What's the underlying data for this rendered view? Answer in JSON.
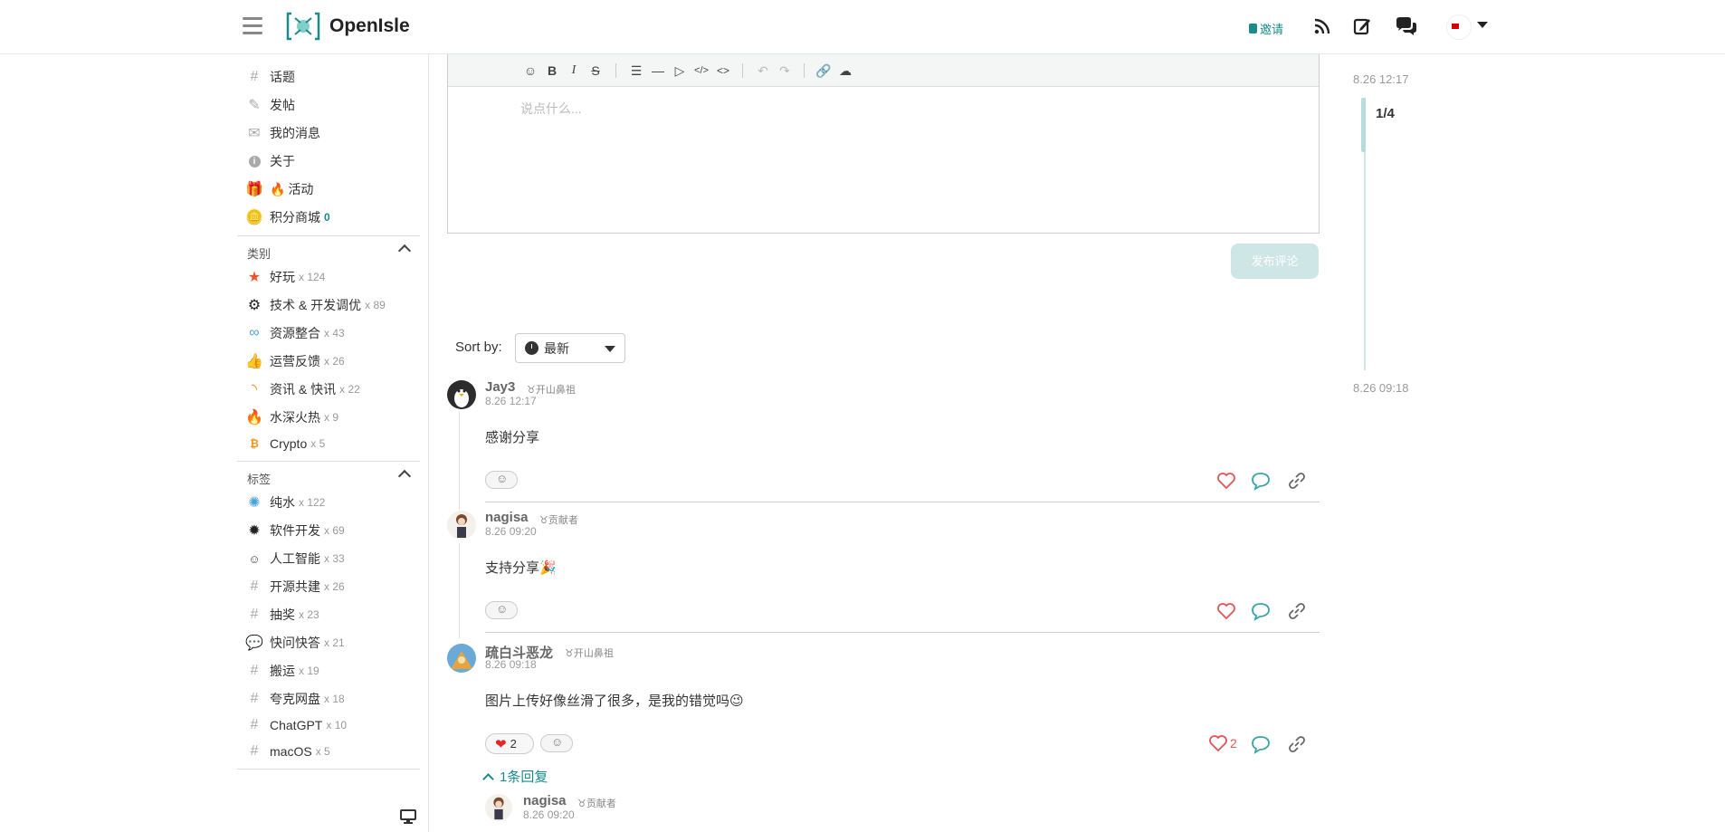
{
  "header": {
    "brand": "OpenIsle",
    "invite_label": "邀请"
  },
  "sidebar": {
    "nav": [
      {
        "label": "话题",
        "icon": "hash-icon"
      },
      {
        "label": "发帖",
        "icon": "edit-icon"
      },
      {
        "label": "我的消息",
        "icon": "mail-icon"
      },
      {
        "label": "关于",
        "icon": "info-icon"
      },
      {
        "label": "活动",
        "icon": "gift-icon"
      },
      {
        "label": "积分商城",
        "icon": "coins-icon",
        "count": "0"
      }
    ],
    "categories_title": "类别",
    "categories": [
      {
        "label": "好玩",
        "count": "x 124"
      },
      {
        "label": "技术 & 开发调优",
        "count": "x 89"
      },
      {
        "label": "资源整合",
        "count": "x 43"
      },
      {
        "label": "运营反馈",
        "count": "x 26"
      },
      {
        "label": "资讯 & 快讯",
        "count": "x 22"
      },
      {
        "label": "水深火热",
        "count": "x 9"
      },
      {
        "label": "Crypto",
        "count": "x 5"
      }
    ],
    "tags_title": "标签",
    "tags": [
      {
        "label": "纯水",
        "count": "x 122"
      },
      {
        "label": "软件开发",
        "count": "x 69"
      },
      {
        "label": "人工智能",
        "count": "x 33"
      },
      {
        "label": "开源共建",
        "count": "x 26"
      },
      {
        "label": "抽奖",
        "count": "x 23"
      },
      {
        "label": "快问快答",
        "count": "x 21"
      },
      {
        "label": "搬运",
        "count": "x 19"
      },
      {
        "label": "夸克网盘",
        "count": "x 18"
      },
      {
        "label": "ChatGPT",
        "count": "x 10"
      },
      {
        "label": "macOS",
        "count": "x 5"
      }
    ]
  },
  "editor": {
    "placeholder": "说点什么...",
    "submit_label": "发布评论"
  },
  "sort": {
    "label": "Sort by:",
    "selected": "最新"
  },
  "timeline": {
    "top_time": "8.26 12:17",
    "position": "1/4",
    "bottom_time": "8.26 09:18"
  },
  "comments": [
    {
      "author": "Jay3",
      "badge": "开山鼻祖",
      "time": "8.26 12:17",
      "text": "感谢分享"
    },
    {
      "author": "nagisa",
      "badge": "贡献者",
      "time": "8.26 09:20",
      "text": "支持分享🎉"
    },
    {
      "author": "疏白斗恶龙",
      "badge": "开山鼻祖",
      "time": "8.26 09:18",
      "text": "图片上传好像丝滑了很多，是我的错觉吗😉",
      "heart_count": "2",
      "like_count": "2"
    }
  ],
  "replies": {
    "toggle_label": "1条回复",
    "items": [
      {
        "author": "nagisa",
        "badge": "贡献者",
        "time": "8.26 09:20"
      }
    ]
  },
  "colors": {
    "accent": "#1a8a8a",
    "like_red": "#e45555"
  }
}
